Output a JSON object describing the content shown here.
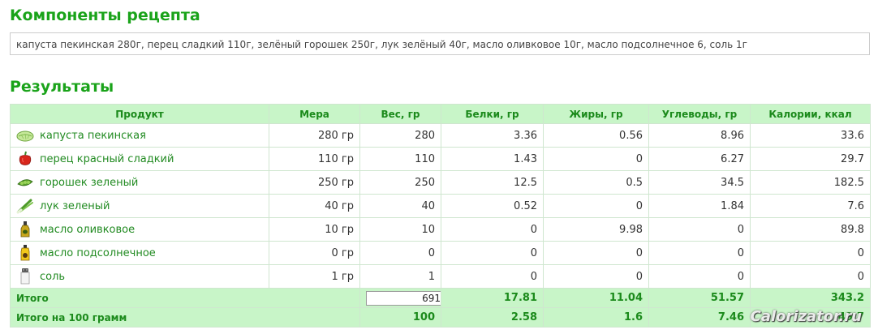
{
  "recipe_components": {
    "title": "Компоненты рецепта",
    "ingredients_text": "капуста пекинская 280г, перец сладкий 110г, зелёный горошек 250г, лук зелёный 40г, масло оливковое 10г, масло подсолнечное 6, соль 1г"
  },
  "results": {
    "title": "Результаты",
    "columns": [
      "Продукт",
      "Мера",
      "Вес, гр",
      "Белки, гр",
      "Жиры, гр",
      "Углеводы, гр",
      "Калории, ккал"
    ],
    "rows": [
      {
        "product": "капуста пекинская",
        "icon": "cabbage-icon",
        "measure": "280 гр",
        "weight": "280",
        "protein": "3.36",
        "fat": "0.56",
        "carbs": "8.96",
        "kcal": "33.6"
      },
      {
        "product": "перец красный сладкий",
        "icon": "red-pepper-icon",
        "measure": "110 гр",
        "weight": "110",
        "protein": "1.43",
        "fat": "0",
        "carbs": "6.27",
        "kcal": "29.7"
      },
      {
        "product": "горошек зеленый",
        "icon": "green-peas-icon",
        "measure": "250 гр",
        "weight": "250",
        "protein": "12.5",
        "fat": "0.5",
        "carbs": "34.5",
        "kcal": "182.5"
      },
      {
        "product": "лук зеленый",
        "icon": "green-onion-icon",
        "measure": "40 гр",
        "weight": "40",
        "protein": "0.52",
        "fat": "0",
        "carbs": "1.84",
        "kcal": "7.6"
      },
      {
        "product": "масло оливковое",
        "icon": "olive-oil-icon",
        "measure": "10 гр",
        "weight": "10",
        "protein": "0",
        "fat": "9.98",
        "carbs": "0",
        "kcal": "89.8"
      },
      {
        "product": "масло подсолнечное",
        "icon": "sunflower-oil-icon",
        "measure": "0 гр",
        "weight": "0",
        "protein": "0",
        "fat": "0",
        "carbs": "0",
        "kcal": "0"
      },
      {
        "product": "соль",
        "icon": "salt-icon",
        "measure": "1 гр",
        "weight": "1",
        "protein": "0",
        "fat": "0",
        "carbs": "0",
        "kcal": "0"
      }
    ],
    "total": {
      "label": "Итого",
      "weight_value": "691",
      "protein": "17.81",
      "fat": "11.04",
      "carbs": "51.57",
      "kcal": "343.2"
    },
    "per100": {
      "label": "Итого на 100 грамм",
      "weight": "100",
      "protein": "2.58",
      "fat": "1.6",
      "carbs": "7.46",
      "kcal": "49.7"
    }
  },
  "watermark": "Calorizator.ru",
  "colors": {
    "heading_green": "#1aa31a",
    "header_bg": "#c8f5c8",
    "header_text": "#1b8a1b",
    "product_link": "#228b22",
    "border": "#cfe6cf"
  }
}
